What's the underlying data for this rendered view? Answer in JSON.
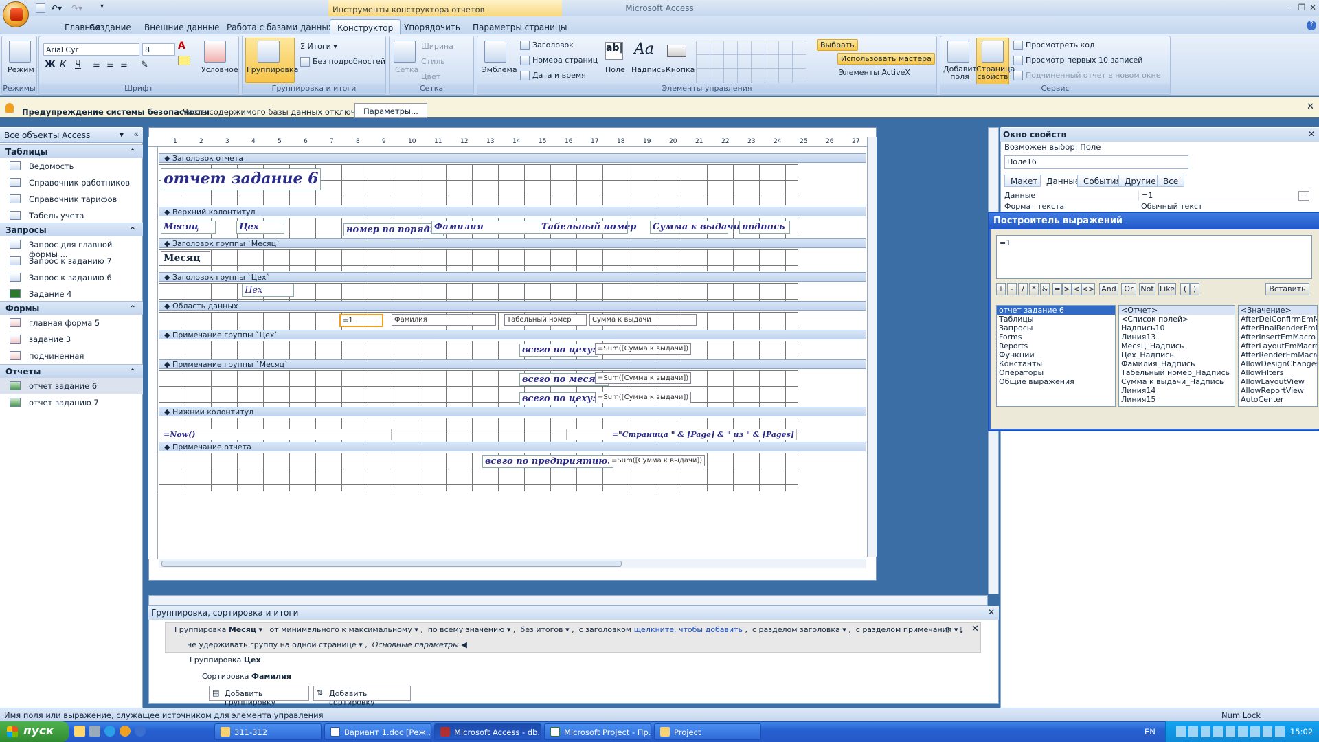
{
  "app": {
    "title": "Microsoft Access",
    "context_tab_title": "Инструменты конструктора отчетов"
  },
  "tabs": [
    "Главная",
    "Создание",
    "Внешние данные",
    "Работа с базами данных",
    "Конструктор",
    "Упорядочить",
    "Параметры страницы"
  ],
  "ribbon": {
    "modes": {
      "view_label": "Режим",
      "group": "Режимы"
    },
    "font": {
      "name": "Arial Cyr",
      "size": "8",
      "group": "Шрифт",
      "conditional": "Условное"
    },
    "grouping": {
      "group_btn": "Группировка",
      "totals": "Итоги",
      "no_details": "Без подробностей",
      "group": "Группировка и итоги"
    },
    "grid": {
      "grid_btn": "Сетка",
      "width": "Ширина",
      "style": "Стиль",
      "color": "Цвет",
      "group": "Сетка"
    },
    "controls": {
      "logo": "Эмблема",
      "title": "Заголовок",
      "page_numbers": "Номера страниц",
      "date_time": "Дата и время",
      "field": "Поле",
      "label": "Надпись",
      "button": "Кнопка",
      "select": "Выбрать",
      "use_wizard": "Использовать мастера",
      "activex": "Элементы ActiveX",
      "group": "Элементы управления"
    },
    "tools": {
      "add_fields": "Добавить поля",
      "property_sheet": "Страница свойств",
      "view_code": "Просмотреть код",
      "preview_top10": "Просмотр первых 10 записей",
      "subreport": "Подчиненный отчет в новом окне",
      "group": "Сервис"
    }
  },
  "security_bar": {
    "title": "Предупреждение системы безопасности",
    "text": "Часть содержимого базы данных отключено",
    "button": "Параметры..."
  },
  "nav": {
    "header": "Все объекты Access",
    "sections": [
      {
        "name": "Таблицы",
        "items": [
          "Ведомость",
          "Справочник работников",
          "Справочник тарифов",
          "Табель учета"
        ]
      },
      {
        "name": "Запросы",
        "items": [
          "Запрос для главной формы ...",
          "Запрос к заданию 7",
          "Запрос к заданию 6",
          "Задание 4"
        ]
      },
      {
        "name": "Формы",
        "items": [
          "главная форма 5",
          "задание 3",
          "подчиненная"
        ]
      },
      {
        "name": "Отчеты",
        "items": [
          "отчет задание 6",
          "отчет заданию 7"
        ]
      }
    ]
  },
  "ruler_marks": [
    "1",
    "2",
    "3",
    "4",
    "5",
    "6",
    "7",
    "8",
    "9",
    "10",
    "11",
    "12",
    "13",
    "14",
    "15",
    "16",
    "17",
    "18",
    "19",
    "20",
    "21",
    "22",
    "23",
    "24",
    "25",
    "26",
    "27"
  ],
  "report": {
    "bands": {
      "report_header": "Заголовок отчета",
      "page_header": "Верхний колонтитул",
      "group_header_month": "Заголовок группы `Месяц`",
      "group_header_shop": "Заголовок группы `Цех`",
      "detail": "Область данных",
      "group_footer_shop": "Примечание группы `Цех`",
      "group_footer_month": "Примечание группы `Месяц`",
      "page_footer": "Нижний колонтитул",
      "report_footer": "Примечание отчета"
    },
    "title": "отчет задание 6",
    "headers": {
      "month": "Месяц",
      "shop": "Цех",
      "order": "номер по порядку",
      "surname": "Фамилия",
      "tab_num": "Табельный номер",
      "sum": "Сумма к выдачи",
      "sign": "подпись"
    },
    "month_label": "Месяц",
    "shop_label": "Цех",
    "detail": {
      "counter": "=1",
      "surname": "Фамилия",
      "tab_num": "Табельный номер",
      "sum": "Сумма к выдачи"
    },
    "total_shop_label": "всего по цеху:",
    "total_month_label": "всего по месяц:",
    "total_shop2_label": "всего по цеху:",
    "sum_expr": "=Sum([Сумма к выдачи])",
    "now_expr": "=Now()",
    "page_expr": "=\"Страница \" & [Page] & \" из \" & [Pages]",
    "total_company_label": "всего по предприятию:"
  },
  "group_sort": {
    "title": "Группировка, сортировка и итоги",
    "row1": {
      "prefix": "Группировка",
      "field": "Месяц",
      "order": "от минимального к максимальному",
      "by": "по всему значению",
      "totals": "без итогов",
      "header_prefix": "с заголовком",
      "header_link": "щелкните, чтобы добавить",
      "header_section": "с разделом заголовка",
      "footer_section": "с разделом примечания"
    },
    "row1b": {
      "keep": "не удерживать группу на одной странице",
      "less": "Основные параметры"
    },
    "row2": {
      "prefix": "Группировка",
      "field": "Цех"
    },
    "row3": {
      "prefix": "Сортировка",
      "field": "Фамилия"
    },
    "add_group": "Добавить группировку",
    "add_sort": "Добавить сортировку"
  },
  "props": {
    "title": "Окно свойств",
    "selection_label": "Возможен выбор:  Поле",
    "selected": "Поле16",
    "tabs": [
      "Макет",
      "Данные",
      "События",
      "Другие",
      "Все"
    ],
    "rows": [
      {
        "name": "Данные",
        "value": "=1"
      },
      {
        "name": "Формат текста",
        "value": "Обычный текст"
      }
    ]
  },
  "builder": {
    "title": "Построитель выражений",
    "expression": "=1",
    "ops": [
      "+",
      "-",
      "/",
      "*",
      "&",
      "=",
      ">",
      "<",
      "<>",
      "And",
      "Or",
      "Not",
      "Like",
      "(",
      ")"
    ],
    "insert": "Вставить",
    "tree": [
      "отчет задание 6",
      "Таблицы",
      "Запросы",
      "Forms",
      "Reports",
      "Функции",
      "Константы",
      "Операторы",
      "Общие выражения"
    ],
    "middle": [
      "<Отчет>",
      "<Список полей>",
      "Надпись10",
      "Линия13",
      "Месяц_Надпись",
      "Цех_Надпись",
      "Фамилия_Надпись",
      "Табельный номер_Надпись",
      "Сумма к выдачи_Надпись",
      "Линия14",
      "Линия15"
    ],
    "right": [
      "<Значение>",
      "AfterDelConfirmEmMacro",
      "AfterFinalRenderEmMacro",
      "AfterInsertEmMacro",
      "AfterLayoutEmMacro",
      "AfterRenderEmMacro",
      "AllowDesignChanges",
      "AllowFilters",
      "AllowLayoutView",
      "AllowReportView",
      "AutoCenter"
    ]
  },
  "status": {
    "text": "Имя поля или выражение, служащее источником для элемента управления",
    "numlock": "Num Lock"
  },
  "taskbar": {
    "start": "пуск",
    "buttons": [
      "311-312",
      "Вариант 1.doc [Реж...",
      "Microsoft Access - db...",
      "Microsoft Project - Пр...",
      "Project"
    ],
    "lang": "EN",
    "clock": "15:02"
  }
}
